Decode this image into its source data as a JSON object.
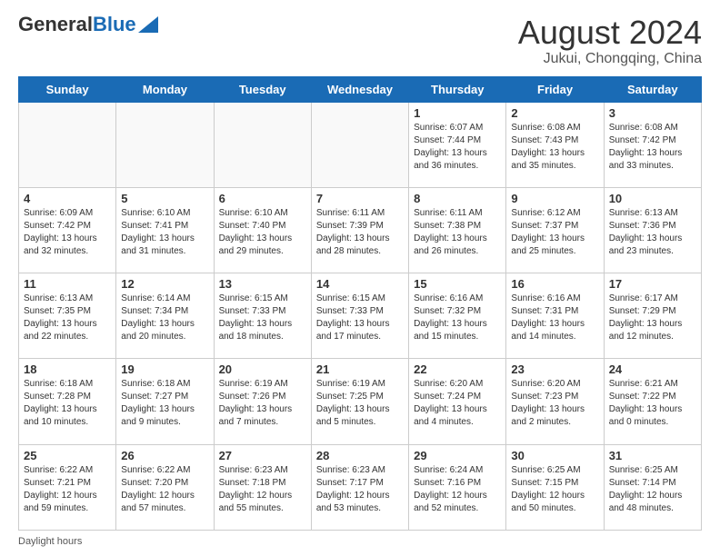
{
  "logo": {
    "text_general": "General",
    "text_blue": "Blue"
  },
  "title": "August 2024",
  "subtitle": "Jukui, Chongqing, China",
  "days_header": [
    "Sunday",
    "Monday",
    "Tuesday",
    "Wednesday",
    "Thursday",
    "Friday",
    "Saturday"
  ],
  "weeks": [
    [
      {
        "day": "",
        "info": ""
      },
      {
        "day": "",
        "info": ""
      },
      {
        "day": "",
        "info": ""
      },
      {
        "day": "",
        "info": ""
      },
      {
        "day": "1",
        "info": "Sunrise: 6:07 AM\nSunset: 7:44 PM\nDaylight: 13 hours\nand 36 minutes."
      },
      {
        "day": "2",
        "info": "Sunrise: 6:08 AM\nSunset: 7:43 PM\nDaylight: 13 hours\nand 35 minutes."
      },
      {
        "day": "3",
        "info": "Sunrise: 6:08 AM\nSunset: 7:42 PM\nDaylight: 13 hours\nand 33 minutes."
      }
    ],
    [
      {
        "day": "4",
        "info": "Sunrise: 6:09 AM\nSunset: 7:42 PM\nDaylight: 13 hours\nand 32 minutes."
      },
      {
        "day": "5",
        "info": "Sunrise: 6:10 AM\nSunset: 7:41 PM\nDaylight: 13 hours\nand 31 minutes."
      },
      {
        "day": "6",
        "info": "Sunrise: 6:10 AM\nSunset: 7:40 PM\nDaylight: 13 hours\nand 29 minutes."
      },
      {
        "day": "7",
        "info": "Sunrise: 6:11 AM\nSunset: 7:39 PM\nDaylight: 13 hours\nand 28 minutes."
      },
      {
        "day": "8",
        "info": "Sunrise: 6:11 AM\nSunset: 7:38 PM\nDaylight: 13 hours\nand 26 minutes."
      },
      {
        "day": "9",
        "info": "Sunrise: 6:12 AM\nSunset: 7:37 PM\nDaylight: 13 hours\nand 25 minutes."
      },
      {
        "day": "10",
        "info": "Sunrise: 6:13 AM\nSunset: 7:36 PM\nDaylight: 13 hours\nand 23 minutes."
      }
    ],
    [
      {
        "day": "11",
        "info": "Sunrise: 6:13 AM\nSunset: 7:35 PM\nDaylight: 13 hours\nand 22 minutes."
      },
      {
        "day": "12",
        "info": "Sunrise: 6:14 AM\nSunset: 7:34 PM\nDaylight: 13 hours\nand 20 minutes."
      },
      {
        "day": "13",
        "info": "Sunrise: 6:15 AM\nSunset: 7:33 PM\nDaylight: 13 hours\nand 18 minutes."
      },
      {
        "day": "14",
        "info": "Sunrise: 6:15 AM\nSunset: 7:33 PM\nDaylight: 13 hours\nand 17 minutes."
      },
      {
        "day": "15",
        "info": "Sunrise: 6:16 AM\nSunset: 7:32 PM\nDaylight: 13 hours\nand 15 minutes."
      },
      {
        "day": "16",
        "info": "Sunrise: 6:16 AM\nSunset: 7:31 PM\nDaylight: 13 hours\nand 14 minutes."
      },
      {
        "day": "17",
        "info": "Sunrise: 6:17 AM\nSunset: 7:29 PM\nDaylight: 13 hours\nand 12 minutes."
      }
    ],
    [
      {
        "day": "18",
        "info": "Sunrise: 6:18 AM\nSunset: 7:28 PM\nDaylight: 13 hours\nand 10 minutes."
      },
      {
        "day": "19",
        "info": "Sunrise: 6:18 AM\nSunset: 7:27 PM\nDaylight: 13 hours\nand 9 minutes."
      },
      {
        "day": "20",
        "info": "Sunrise: 6:19 AM\nSunset: 7:26 PM\nDaylight: 13 hours\nand 7 minutes."
      },
      {
        "day": "21",
        "info": "Sunrise: 6:19 AM\nSunset: 7:25 PM\nDaylight: 13 hours\nand 5 minutes."
      },
      {
        "day": "22",
        "info": "Sunrise: 6:20 AM\nSunset: 7:24 PM\nDaylight: 13 hours\nand 4 minutes."
      },
      {
        "day": "23",
        "info": "Sunrise: 6:20 AM\nSunset: 7:23 PM\nDaylight: 13 hours\nand 2 minutes."
      },
      {
        "day": "24",
        "info": "Sunrise: 6:21 AM\nSunset: 7:22 PM\nDaylight: 13 hours\nand 0 minutes."
      }
    ],
    [
      {
        "day": "25",
        "info": "Sunrise: 6:22 AM\nSunset: 7:21 PM\nDaylight: 12 hours\nand 59 minutes."
      },
      {
        "day": "26",
        "info": "Sunrise: 6:22 AM\nSunset: 7:20 PM\nDaylight: 12 hours\nand 57 minutes."
      },
      {
        "day": "27",
        "info": "Sunrise: 6:23 AM\nSunset: 7:18 PM\nDaylight: 12 hours\nand 55 minutes."
      },
      {
        "day": "28",
        "info": "Sunrise: 6:23 AM\nSunset: 7:17 PM\nDaylight: 12 hours\nand 53 minutes."
      },
      {
        "day": "29",
        "info": "Sunrise: 6:24 AM\nSunset: 7:16 PM\nDaylight: 12 hours\nand 52 minutes."
      },
      {
        "day": "30",
        "info": "Sunrise: 6:25 AM\nSunset: 7:15 PM\nDaylight: 12 hours\nand 50 minutes."
      },
      {
        "day": "31",
        "info": "Sunrise: 6:25 AM\nSunset: 7:14 PM\nDaylight: 12 hours\nand 48 minutes."
      }
    ]
  ],
  "footer": {
    "daylight_label": "Daylight hours"
  }
}
